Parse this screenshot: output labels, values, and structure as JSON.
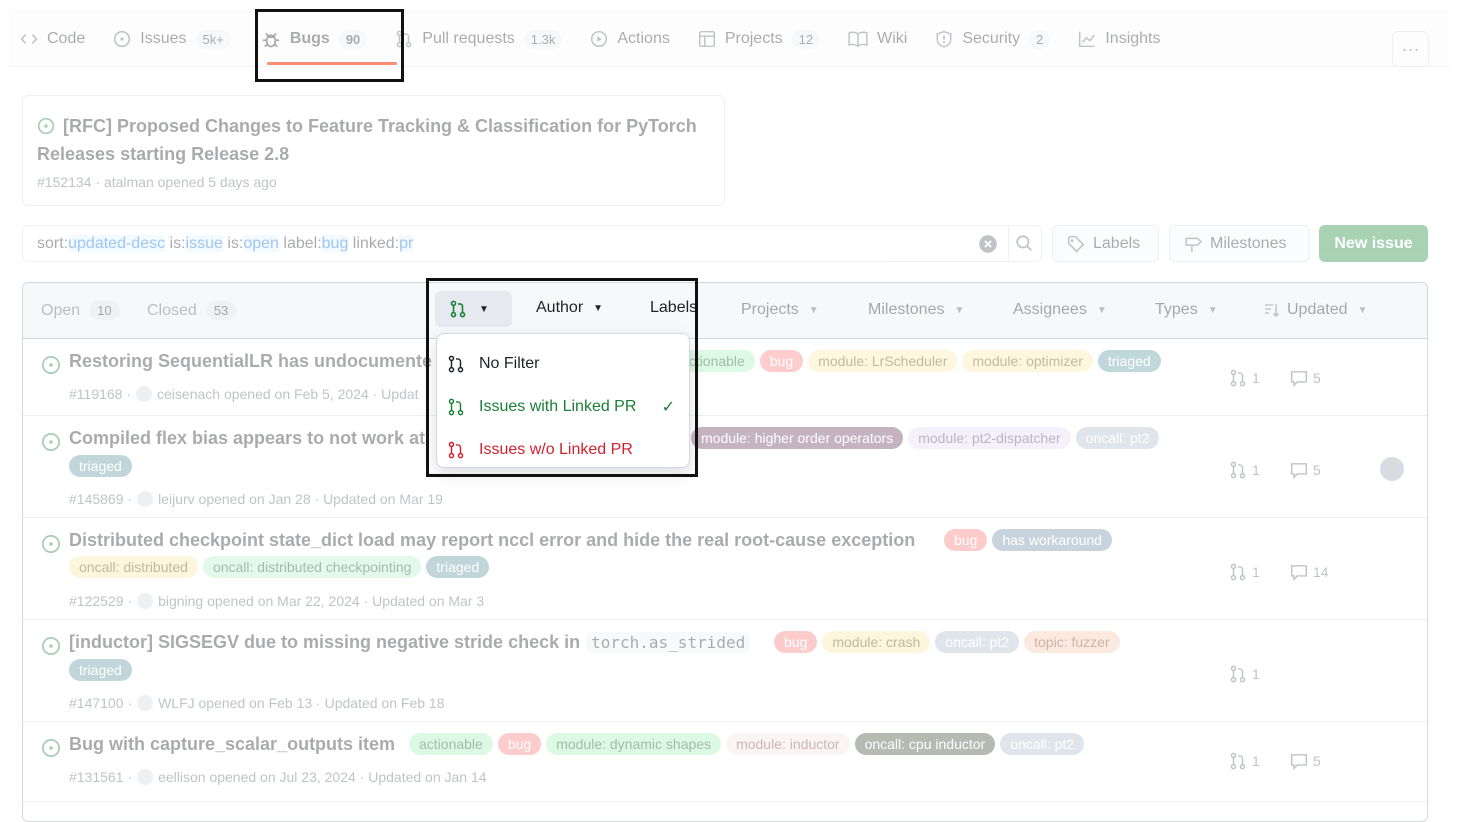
{
  "tabs": [
    {
      "icon": "code-icon",
      "label": "Code",
      "count": ""
    },
    {
      "icon": "issue-open-icon",
      "label": "Issues",
      "count": "5k+"
    },
    {
      "icon": "bug-icon",
      "label": "Bugs",
      "count": "90"
    },
    {
      "icon": "git-pull-request-icon",
      "label": "Pull requests",
      "count": "1.3k"
    },
    {
      "icon": "play-icon",
      "label": "Actions",
      "count": ""
    },
    {
      "icon": "table-icon",
      "label": "Projects",
      "count": "12"
    },
    {
      "icon": "book-icon",
      "label": "Wiki",
      "count": ""
    },
    {
      "icon": "shield-icon",
      "label": "Security",
      "count": "2"
    },
    {
      "icon": "graph-icon",
      "label": "Insights",
      "count": ""
    }
  ],
  "more_label": "···",
  "pinned": {
    "title_line1": "[RFC] Proposed Changes to Feature Tracking & Classification for PyTorch",
    "title_line2": "Releases starting Release 2.8",
    "meta": "#152134 · atalman opened 5 days ago"
  },
  "search": {
    "query": [
      {
        "k": "sort:",
        "v": "updated-desc"
      },
      {
        "k": " is:",
        "v": "issue"
      },
      {
        "k": " is:",
        "v": "open"
      },
      {
        "k": " label:",
        "v": "bug"
      },
      {
        "k": " linked:",
        "v": "pr"
      }
    ]
  },
  "buttons": {
    "labels": "Labels",
    "milestones": "Milestones",
    "new_issue": "New issue"
  },
  "list_header": {
    "open_label": "Open",
    "open_count": "10",
    "closed_label": "Closed",
    "closed_count": "53",
    "author": "Author",
    "labels": "Labels",
    "projects": "Projects",
    "milestones": "Milestones",
    "assignees": "Assignees",
    "types": "Types",
    "updated": "Updated"
  },
  "dropdown": {
    "items": [
      {
        "label": "No Filter",
        "color": "#1f2328",
        "checked": false
      },
      {
        "label": "Issues with Linked PR",
        "color": "#1a7f37",
        "checked": true
      },
      {
        "label": "Issues w/o Linked PR",
        "color": "#cf222e",
        "checked": false
      }
    ],
    "check": "✓"
  },
  "issues": [
    {
      "title": "Restoring SequentialLR has undocumente",
      "labels_inline": [
        {
          "text": "actionable",
          "bg": "#a6f2b7",
          "fg": "#0e4d1f"
        },
        {
          "text": "bug",
          "bg": "#f97a7a",
          "fg": "#fff"
        },
        {
          "text": "module: LrScheduler",
          "bg": "#fbe8a6",
          "fg": "#5c4a05"
        },
        {
          "text": "module: optimizer",
          "bg": "#fbe8a6",
          "fg": "#5c4a05"
        },
        {
          "text": "triaged",
          "bg": "#5b96a3",
          "fg": "#fff"
        }
      ],
      "meta": "#119168 ·",
      "author": "ceisenach",
      "meta_rest": "opened on Feb 5, 2024 · Updat",
      "prs": "1",
      "comments": "5"
    },
    {
      "title": "Compiled flex bias appears to not work at",
      "labels_inline": [
        {
          "text": "module: higher order operators",
          "bg": "#6b3b5c",
          "fg": "#fff"
        },
        {
          "text": "module: pt2-dispatcher",
          "bg": "#e5dcf5",
          "fg": "#4a3a70"
        },
        {
          "text": "oncall: pt2",
          "bg": "#aebccb",
          "fg": "#fff"
        }
      ],
      "labels_second": [
        {
          "text": "triaged",
          "bg": "#5b96a3",
          "fg": "#fff"
        }
      ],
      "meta": "#145869 ·",
      "author": "leijurv",
      "meta_rest": "opened on Jan 28 · Updated on Mar 19",
      "prs": "1",
      "comments": "5"
    },
    {
      "title": "Distributed checkpoint state_dict load may report nccl error and hide the real root-cause exception",
      "labels_inline": [
        {
          "text": "bug",
          "bg": "#f97a7a",
          "fg": "#fff"
        },
        {
          "text": "has workaround",
          "bg": "#6e8fa8",
          "fg": "#fff"
        }
      ],
      "labels_second": [
        {
          "text": "oncall: distributed",
          "bg": "#fbe8a6",
          "fg": "#5c4a05"
        },
        {
          "text": "oncall: distributed checkpointing",
          "bg": "#b9f0cf",
          "fg": "#0e4d2b"
        },
        {
          "text": "triaged",
          "bg": "#5b96a3",
          "fg": "#fff"
        }
      ],
      "meta": "#122529 ·",
      "author": "bigning",
      "meta_rest": "opened on Mar 22, 2024 · Updated on Mar 3",
      "prs": "1",
      "comments": "14"
    },
    {
      "title": "[inductor] SIGSEGV due to missing negative stride check in",
      "code": "torch.as_strided",
      "labels_inline": [
        {
          "text": "bug",
          "bg": "#f97a7a",
          "fg": "#fff"
        },
        {
          "text": "module: crash",
          "bg": "#fbe8a6",
          "fg": "#5c4a05"
        },
        {
          "text": "oncall: pt2",
          "bg": "#aebccb",
          "fg": "#fff"
        },
        {
          "text": "topic: fuzzer",
          "bg": "#f9c7b0",
          "fg": "#7a3a1c"
        }
      ],
      "labels_second": [
        {
          "text": "triaged",
          "bg": "#5b96a3",
          "fg": "#fff"
        }
      ],
      "meta": "#147100 ·",
      "author": "WLFJ",
      "meta_rest": "opened on Feb 13 · Updated on Feb 18",
      "prs": "1",
      "comments": ""
    },
    {
      "title": "Bug with capture_scalar_outputs item",
      "labels_inline": [
        {
          "text": "actionable",
          "bg": "#a6f2b7",
          "fg": "#0e4d1f"
        },
        {
          "text": "bug",
          "bg": "#f97a7a",
          "fg": "#fff"
        },
        {
          "text": "module: dynamic shapes",
          "bg": "#a6f2b7",
          "fg": "#0e4d1f"
        },
        {
          "text": "module: inductor",
          "bg": "#f6e3e3",
          "fg": "#7a4040"
        },
        {
          "text": "oncall: cpu inductor",
          "bg": "#3f4b3a",
          "fg": "#fff"
        },
        {
          "text": "oncall: pt2",
          "bg": "#aebccb",
          "fg": "#fff"
        }
      ],
      "meta": "#131561 ·",
      "author": "eellison",
      "meta_rest": "opened on Jul 23, 2024 · Updated on Jan 14",
      "prs": "1",
      "comments": "5"
    }
  ]
}
